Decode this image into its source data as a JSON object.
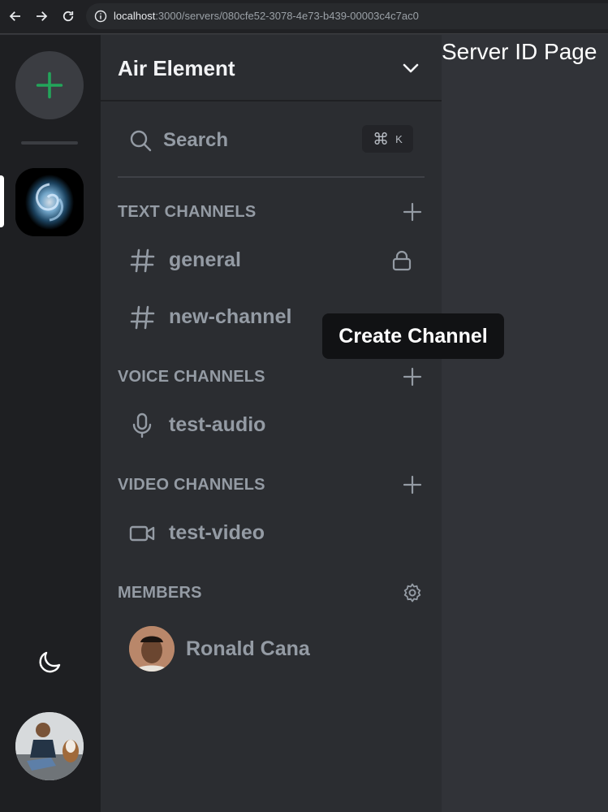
{
  "browser": {
    "url_host": "localhost",
    "url_rest": ":3000/servers/080cfe52-3078-4e73-b439-00003c4c7ac0"
  },
  "rail": {
    "accent_color": "#23a55a",
    "icons": [
      "plus-icon",
      "moon-icon"
    ]
  },
  "sidebar": {
    "server_name": "Air Element",
    "search_label": "Search",
    "shortcut_symbol": "⌘",
    "shortcut_key": "K",
    "sections": {
      "text": {
        "title": "TEXT CHANNELS"
      },
      "voice": {
        "title": "VOICE CHANNELS"
      },
      "video": {
        "title": "VIDEO CHANNELS"
      },
      "members": {
        "title": "MEMBERS"
      }
    },
    "channels": {
      "general": "general",
      "new_channel": "new-channel",
      "audio": "test-audio",
      "video": "test-video"
    },
    "member_name": "Ronald Cana"
  },
  "main": {
    "page_text": "Server ID Page"
  },
  "tooltip": {
    "text": "Create Channel"
  }
}
